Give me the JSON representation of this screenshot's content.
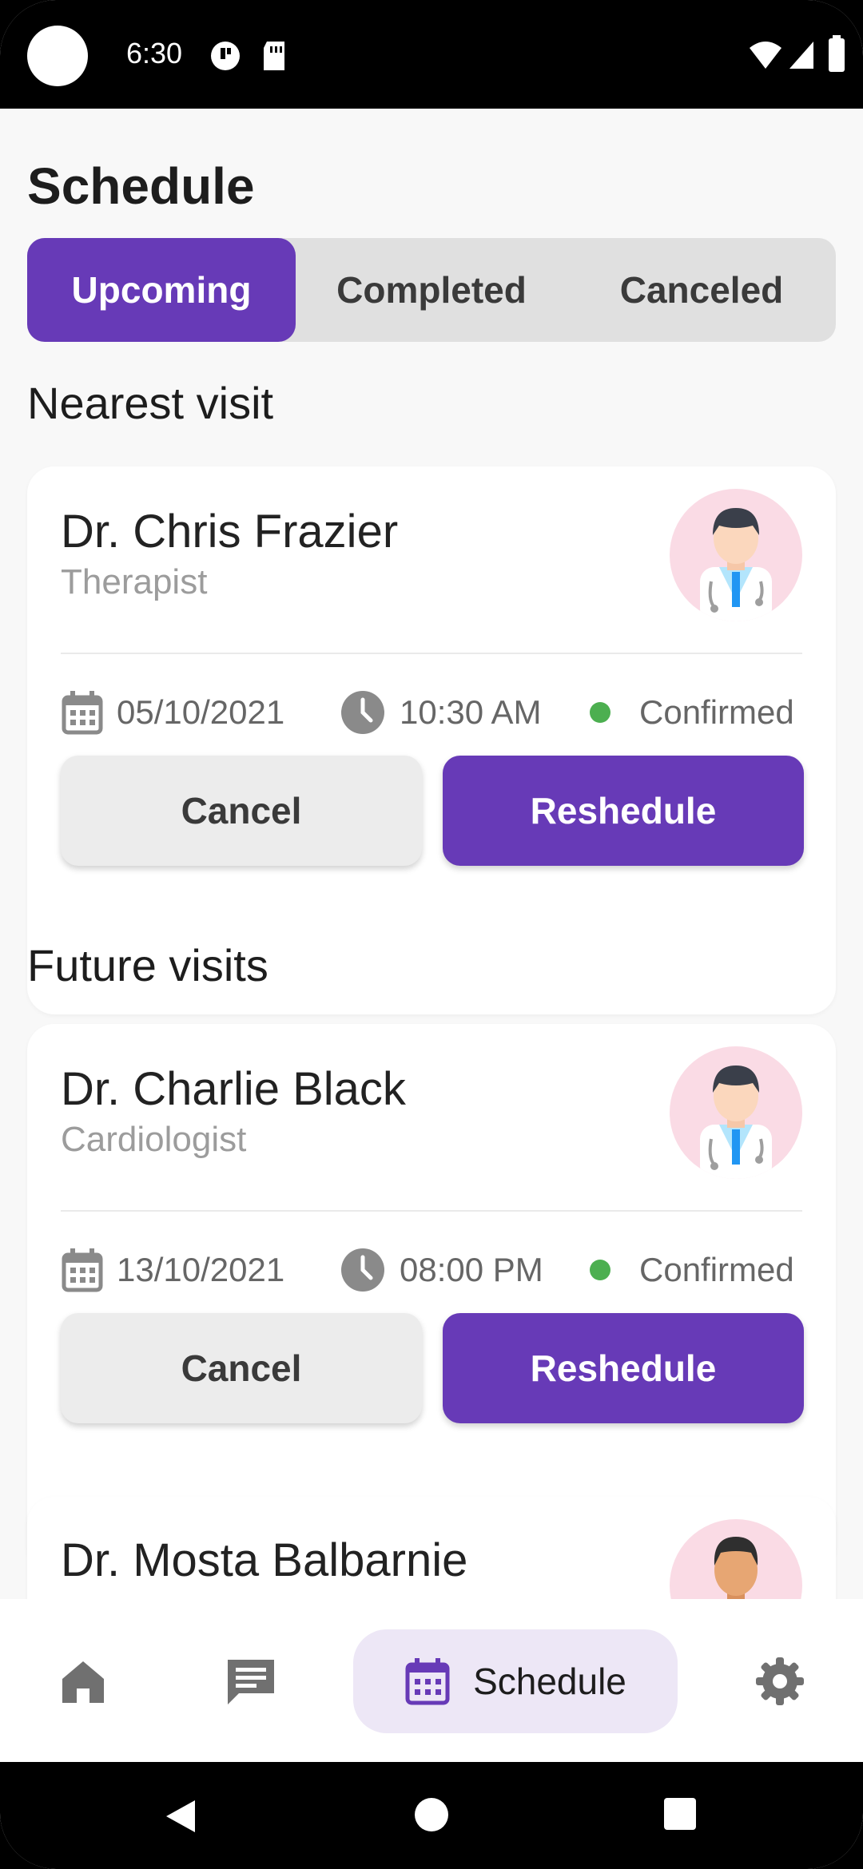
{
  "status_bar": {
    "time": "6:30"
  },
  "page": {
    "title": "Schedule"
  },
  "tabs": [
    {
      "label": "Upcoming",
      "active": true
    },
    {
      "label": "Completed",
      "active": false
    },
    {
      "label": "Canceled",
      "active": false
    }
  ],
  "sections": {
    "nearest": "Nearest visit",
    "future": "Future visits"
  },
  "visits": [
    {
      "name": "Dr. Chris Frazier",
      "specialty": "Therapist",
      "date": "05/10/2021",
      "time": "10:30 AM",
      "status": "Confirmed",
      "cancel_label": "Cancel",
      "reschedule_label": "Reshedule"
    },
    {
      "name": "Dr. Charlie Black",
      "specialty": "Cardiologist",
      "date": "13/10/2021",
      "time": "08:00 PM",
      "status": "Confirmed",
      "cancel_label": "Cancel",
      "reschedule_label": "Reshedule"
    },
    {
      "name": "Dr. Mosta Balbarnie"
    }
  ],
  "bottom_nav": {
    "items": [
      {
        "icon": "home-icon"
      },
      {
        "icon": "chat-icon"
      },
      {
        "icon": "calendar-icon",
        "label": "Schedule",
        "active": true
      },
      {
        "icon": "gear-icon"
      }
    ]
  },
  "colors": {
    "accent": "#673ab7",
    "status_confirmed": "#4caf50",
    "avatar_bg": "#fadbe5"
  }
}
